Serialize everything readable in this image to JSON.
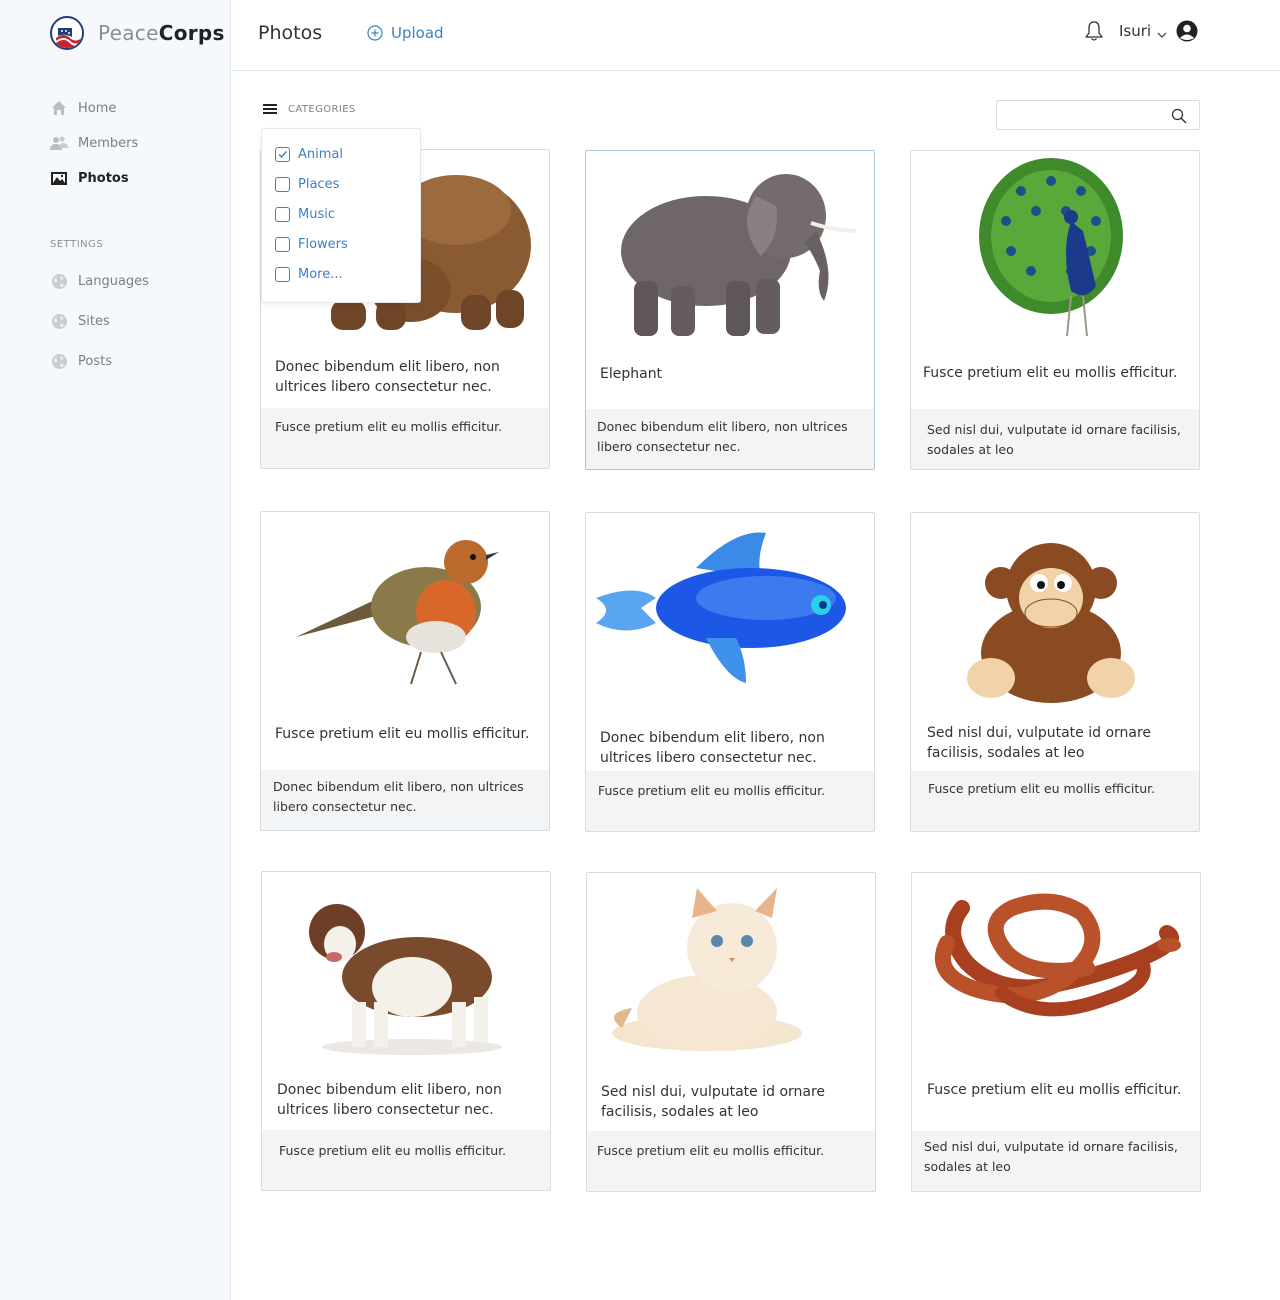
{
  "app": {
    "brand_light": "Peace",
    "brand_bold": "Corps",
    "logo_text": "PEACE CORPS"
  },
  "sidebar": {
    "items": [
      {
        "label": "Home",
        "icon": "home-icon"
      },
      {
        "label": "Members",
        "icon": "members-icon"
      },
      {
        "label": "Photos",
        "icon": "photos-icon",
        "active": true
      }
    ],
    "settings_label": "SETTINGS",
    "settings_items": [
      {
        "label": "Languages",
        "icon": "globe-icon"
      },
      {
        "label": "Sites",
        "icon": "globe-icon"
      },
      {
        "label": "Posts",
        "icon": "globe-icon"
      }
    ]
  },
  "header": {
    "title": "Photos",
    "upload_label": "Upload",
    "user_name": "Isuri"
  },
  "toolbar": {
    "categories_label": "CATEGORIES",
    "search_placeholder": ""
  },
  "categories": [
    {
      "label": "Animal",
      "checked": true
    },
    {
      "label": "Places",
      "checked": false
    },
    {
      "label": "Music",
      "checked": false
    },
    {
      "label": "Flowers",
      "checked": false
    },
    {
      "label": "More...",
      "checked": false
    }
  ],
  "colors": {
    "accent": "#3a82c4",
    "sidebar_bg": "#f5f9fc",
    "card_footer_bg": "#f3f4f5"
  },
  "cards": [
    {
      "image": "bear",
      "caption": "Donec bibendum elit libero, non ultrices libero consectetur nec.",
      "footer": "Fusce pretium elit eu mollis efficitur."
    },
    {
      "image": "elephant",
      "caption": "Elephant",
      "footer": "Donec bibendum elit libero, non ultrices libero consectetur nec.",
      "selected": true
    },
    {
      "image": "peacock",
      "caption": "Fusce pretium elit eu mollis efficitur.",
      "footer": "Sed nisl dui, vulputate id ornare facilisis, sodales at leo"
    },
    {
      "image": "robin",
      "caption": "Fusce pretium elit eu mollis efficitur.",
      "footer": "Donec bibendum elit libero, non ultrices libero consectetur nec."
    },
    {
      "image": "fish",
      "caption": "Donec bibendum elit libero, non ultrices libero consectetur nec.",
      "footer": "Fusce pretium elit eu mollis efficitur."
    },
    {
      "image": "monkey",
      "caption": "Sed nisl dui, vulputate id ornare facilisis, sodales at leo",
      "footer": "Fusce pretium elit eu mollis efficitur."
    },
    {
      "image": "dog",
      "caption": "Donec bibendum elit libero, non ultrices libero consectetur nec.",
      "footer": "Fusce pretium elit eu mollis efficitur."
    },
    {
      "image": "cat",
      "caption": "Sed nisl dui, vulputate id ornare facilisis, sodales at leo",
      "footer": "Fusce pretium elit eu mollis efficitur."
    },
    {
      "image": "snake",
      "caption": "Fusce pretium elit eu mollis efficitur.",
      "footer": "Sed nisl dui, vulputate id ornare facilisis, sodales at leo"
    }
  ]
}
